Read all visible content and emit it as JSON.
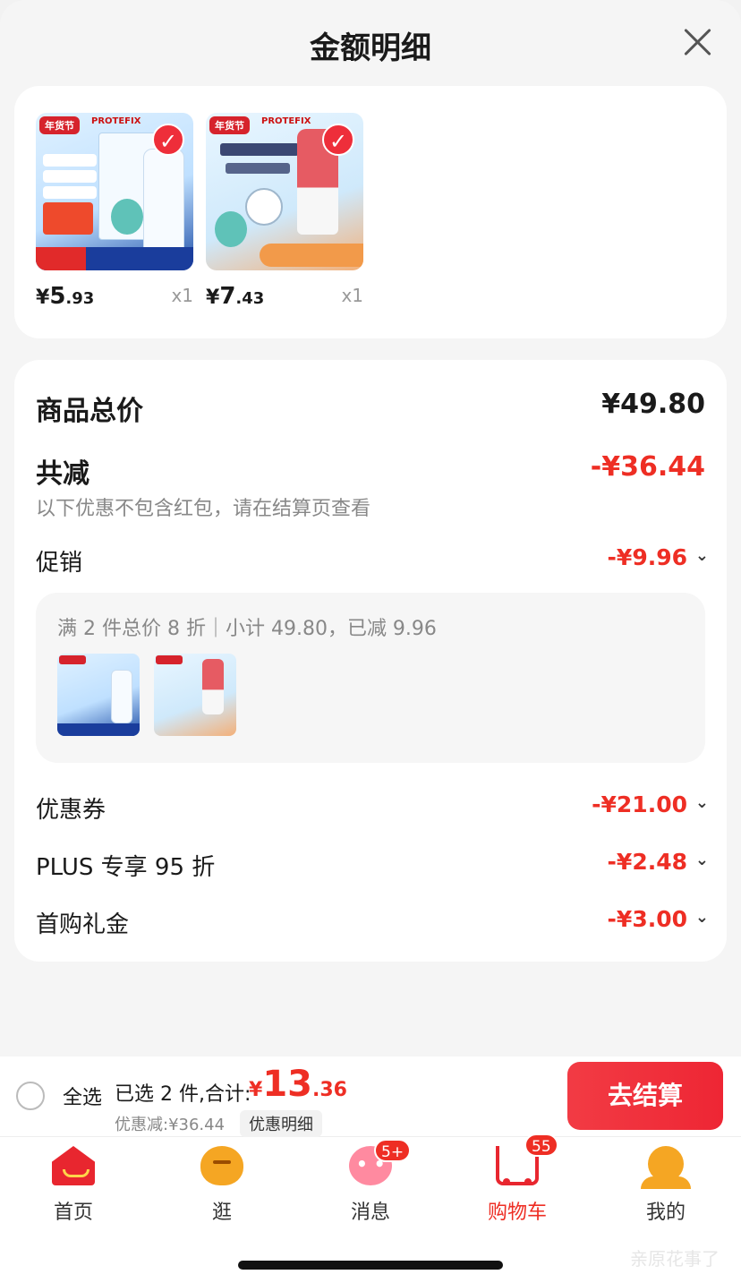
{
  "header": {
    "title": "金额明细"
  },
  "products": [
    {
      "price_yen": "¥",
      "price_int": "5",
      "price_dec": ".93",
      "qty": "x1",
      "brand": "年货节",
      "brand_sub": "PROTEFIX"
    },
    {
      "price_yen": "¥",
      "price_int": "7",
      "price_dec": ".43",
      "qty": "x1",
      "brand": "年货节",
      "brand_sub": "PROTEFIX"
    }
  ],
  "summary": {
    "total_label": "商品总价",
    "total_value": "¥49.80",
    "discount_label": "共减",
    "discount_value": "-¥36.44",
    "note": "以下优惠不包含红包，请在结算页查看",
    "promo": {
      "label": "促销",
      "value": "-¥9.96",
      "detail": "满 2 件总价 8 折｜小计 49.80，已减 9.96"
    },
    "coupon": {
      "label": "优惠券",
      "value": "-¥21.00"
    },
    "plus": {
      "label": "PLUS 专享 95 折",
      "value": "-¥2.48"
    },
    "first_gift": {
      "label": "首购礼金",
      "value": "-¥3.00"
    }
  },
  "bottom_bar": {
    "select_all": "全选",
    "selected_text": "已选 2 件,合计:",
    "total_yen": "¥",
    "total_int": "13",
    "total_dec": ".36",
    "saved": "优惠减:¥36.44",
    "detail_link": "优惠明细",
    "checkout": "去结算"
  },
  "tabbar": {
    "items": [
      {
        "label": "首页",
        "icon": "home-icon"
      },
      {
        "label": "逛",
        "icon": "browse-icon"
      },
      {
        "label": "消息",
        "icon": "message-icon",
        "badge": "5+"
      },
      {
        "label": "购物车",
        "icon": "cart-icon",
        "badge": "55",
        "active": true
      },
      {
        "label": "我的",
        "icon": "profile-icon"
      }
    ]
  },
  "watermark": "亲原花事了",
  "colors": {
    "accent_red": "#ee2e24",
    "button_red": "#f23b44"
  }
}
